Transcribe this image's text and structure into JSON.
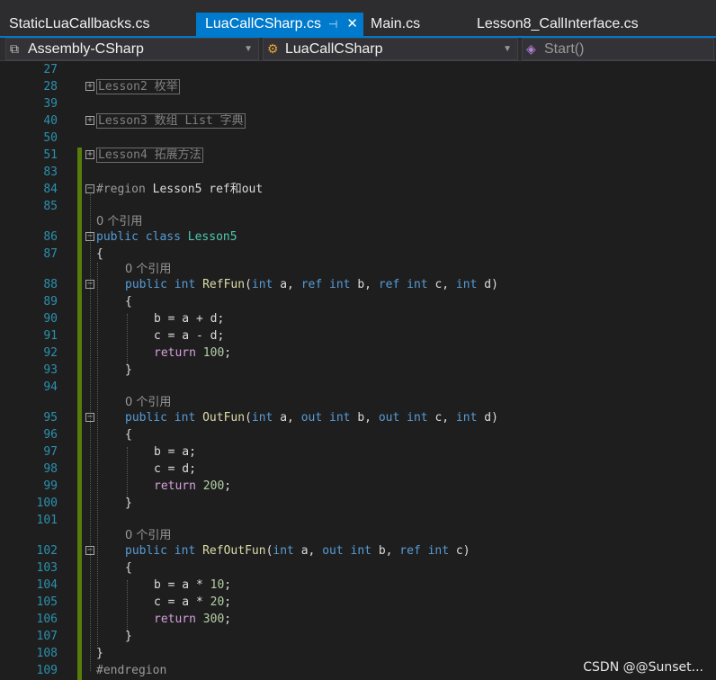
{
  "tabs": [
    {
      "label": "StaticLuaCallbacks.cs"
    },
    {
      "label": "LuaCallCSharp.cs",
      "pin": "⊣",
      "close": "✕"
    },
    {
      "label": "Main.cs"
    },
    {
      "label": "Lesson8_CallInterface.cs"
    }
  ],
  "navbar": {
    "project": "Assembly-CSharp",
    "class": "LuaCallCSharp",
    "member": "Start()"
  },
  "lens": {
    "refs": "0 个引用"
  },
  "lines": {
    "l27": "27",
    "l28": "28",
    "l39": "39",
    "l40": "40",
    "l50": "50",
    "l51": "51",
    "l83": "83",
    "l84": "84",
    "l85": "85",
    "l86": "86",
    "l87": "87",
    "l88": "88",
    "l89": "89",
    "l90": "90",
    "l91": "91",
    "l92": "92",
    "l93": "93",
    "l94": "94",
    "l95": "95",
    "l96": "96",
    "l97": "97",
    "l98": "98",
    "l99": "99",
    "l100": "100",
    "l101": "101",
    "l102": "102",
    "l103": "103",
    "l104": "104",
    "l105": "105",
    "l106": "106",
    "l107": "107",
    "l108": "108",
    "l109": "109"
  },
  "code": {
    "region2": "Lesson2 枚举",
    "region3": "Lesson3 数组 List 字典",
    "region4": "Lesson4 拓展方法",
    "region_kw": "#region",
    "region5": " Lesson5 ref和out",
    "endregion": "#endregion",
    "kw_public": "public",
    "kw_class": "class",
    "kw_int": "int",
    "kw_ref": "ref",
    "kw_out": "out",
    "kw_return": "return",
    "class_name": "Lesson5",
    "fn_ref": "RefFun",
    "fn_out": "OutFun",
    "fn_refout": "RefOutFun",
    "brace_open": "{",
    "brace_close": "}",
    "a": "a",
    "b": "b",
    "c": "c",
    "d": "d",
    "sig_open": "(",
    "sig_close": ")",
    "comma": ", ",
    "stmt_b_plus": "b = a + d;",
    "stmt_c_minus": "c = a - d;",
    "stmt_b_a": "b = a;",
    "stmt_c_d": "c = d;",
    "stmt_b_mul": "b = a * ",
    "stmt_c_mul": "c = a * ",
    "num_10": "10",
    "num_20": "20",
    "num_100": "100",
    "num_200": "200",
    "num_300": "300",
    "semi": ";"
  },
  "watermark": "CSDN @@Sunset..."
}
